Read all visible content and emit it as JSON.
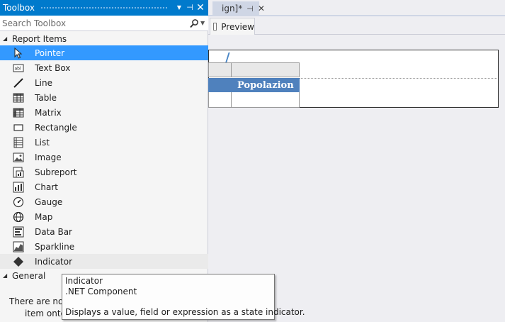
{
  "document": {
    "tab_text": "ign]*",
    "tab_pin": "⊣",
    "tab_close": "✕",
    "preview_tab": "Preview",
    "table_header_text": "Popolazion"
  },
  "toolbox": {
    "title": "Toolbox",
    "header_buttons": {
      "dropdown": "▼",
      "pin": "⊣",
      "close": "✕"
    },
    "search": {
      "placeholder": "Search Toolbox",
      "value": ""
    },
    "groups": [
      {
        "label": "Report Items",
        "expanded": true
      },
      {
        "label": "General",
        "expanded": true
      }
    ],
    "items": [
      {
        "label": "Pointer",
        "icon": "pointer-icon",
        "selected": true
      },
      {
        "label": "Text Box",
        "icon": "textbox-icon"
      },
      {
        "label": "Line",
        "icon": "line-icon"
      },
      {
        "label": "Table",
        "icon": "table-icon"
      },
      {
        "label": "Matrix",
        "icon": "matrix-icon"
      },
      {
        "label": "Rectangle",
        "icon": "rectangle-icon"
      },
      {
        "label": "List",
        "icon": "list-icon"
      },
      {
        "label": "Image",
        "icon": "image-icon"
      },
      {
        "label": "Subreport",
        "icon": "subreport-icon"
      },
      {
        "label": "Chart",
        "icon": "chart-icon"
      },
      {
        "label": "Gauge",
        "icon": "gauge-icon"
      },
      {
        "label": "Map",
        "icon": "map-icon"
      },
      {
        "label": "Data Bar",
        "icon": "databar-icon"
      },
      {
        "label": "Sparkline",
        "icon": "sparkline-icon"
      },
      {
        "label": "Indicator",
        "icon": "indicator-icon",
        "hovered": true
      }
    ],
    "general_empty": {
      "line1": "There are no u",
      "line2": "item onto"
    }
  },
  "tooltip": {
    "title": "Indicator",
    "type": ".NET Component",
    "description": "Displays a value, field or expression as a state indicator."
  },
  "colors": {
    "accent": "#007acc",
    "selection": "#3399ff",
    "table_header": "#4f81bd"
  }
}
